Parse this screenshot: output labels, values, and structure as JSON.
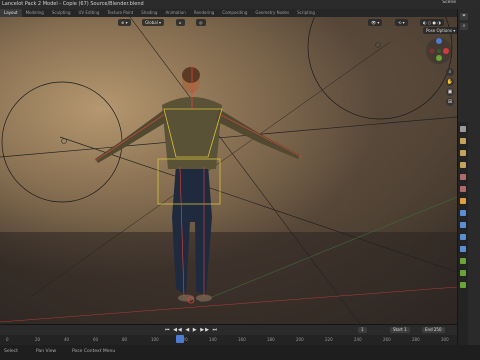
{
  "window": {
    "title": "Lancelot Pack 2 Model - Copie (67) Source/Blender.blend",
    "scene": "Scene"
  },
  "workspace_tabs": [
    {
      "label": "Layout",
      "active": true
    },
    {
      "label": "Modeling",
      "active": false
    },
    {
      "label": "Sculpting",
      "active": false
    },
    {
      "label": "UV Editing",
      "active": false
    },
    {
      "label": "Texture Paint",
      "active": false
    },
    {
      "label": "Shading",
      "active": false
    },
    {
      "label": "Animation",
      "active": false
    },
    {
      "label": "Rendering",
      "active": false
    },
    {
      "label": "Compositing",
      "active": false
    },
    {
      "label": "Geometry Nodes",
      "active": false
    },
    {
      "label": "Scripting",
      "active": false
    }
  ],
  "viewport": {
    "transform_orientation": "Global",
    "pose_options": "Pose Options"
  },
  "nav_gizmo": {
    "x": "X",
    "y": "Y",
    "z": "Z"
  },
  "timeline": {
    "playback_icons": "⏮ ◀◀ ◀ ▶ ▶▶ ⏭",
    "current_frame": "1",
    "start_label": "Start",
    "start_value": "1",
    "end_label": "End",
    "end_value": "250",
    "ruler": [
      "0",
      "20",
      "40",
      "60",
      "80",
      "100",
      "120",
      "140",
      "160",
      "180",
      "200",
      "220",
      "240",
      "260",
      "280",
      "300"
    ]
  },
  "statusbar": {
    "left": "Select",
    "middle": "Pan View",
    "right": "Pose Context Menu"
  },
  "colors": {
    "accent": "#4b7bd3",
    "bone": "#d9c23a",
    "armature_red": "#e0453a"
  }
}
